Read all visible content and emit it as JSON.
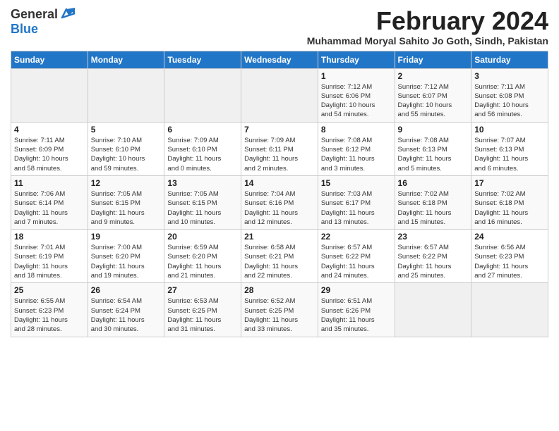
{
  "header": {
    "logo_general": "General",
    "logo_blue": "Blue",
    "title": "February 2024",
    "subtitle": "Muhammad Moryal Sahito Jo Goth, Sindh, Pakistan"
  },
  "days_of_week": [
    "Sunday",
    "Monday",
    "Tuesday",
    "Wednesday",
    "Thursday",
    "Friday",
    "Saturday"
  ],
  "weeks": [
    [
      {
        "day": "",
        "info": ""
      },
      {
        "day": "",
        "info": ""
      },
      {
        "day": "",
        "info": ""
      },
      {
        "day": "",
        "info": ""
      },
      {
        "day": "1",
        "info": "Sunrise: 7:12 AM\nSunset: 6:06 PM\nDaylight: 10 hours\nand 54 minutes."
      },
      {
        "day": "2",
        "info": "Sunrise: 7:12 AM\nSunset: 6:07 PM\nDaylight: 10 hours\nand 55 minutes."
      },
      {
        "day": "3",
        "info": "Sunrise: 7:11 AM\nSunset: 6:08 PM\nDaylight: 10 hours\nand 56 minutes."
      }
    ],
    [
      {
        "day": "4",
        "info": "Sunrise: 7:11 AM\nSunset: 6:09 PM\nDaylight: 10 hours\nand 58 minutes."
      },
      {
        "day": "5",
        "info": "Sunrise: 7:10 AM\nSunset: 6:10 PM\nDaylight: 10 hours\nand 59 minutes."
      },
      {
        "day": "6",
        "info": "Sunrise: 7:09 AM\nSunset: 6:10 PM\nDaylight: 11 hours\nand 0 minutes."
      },
      {
        "day": "7",
        "info": "Sunrise: 7:09 AM\nSunset: 6:11 PM\nDaylight: 11 hours\nand 2 minutes."
      },
      {
        "day": "8",
        "info": "Sunrise: 7:08 AM\nSunset: 6:12 PM\nDaylight: 11 hours\nand 3 minutes."
      },
      {
        "day": "9",
        "info": "Sunrise: 7:08 AM\nSunset: 6:13 PM\nDaylight: 11 hours\nand 5 minutes."
      },
      {
        "day": "10",
        "info": "Sunrise: 7:07 AM\nSunset: 6:13 PM\nDaylight: 11 hours\nand 6 minutes."
      }
    ],
    [
      {
        "day": "11",
        "info": "Sunrise: 7:06 AM\nSunset: 6:14 PM\nDaylight: 11 hours\nand 7 minutes."
      },
      {
        "day": "12",
        "info": "Sunrise: 7:05 AM\nSunset: 6:15 PM\nDaylight: 11 hours\nand 9 minutes."
      },
      {
        "day": "13",
        "info": "Sunrise: 7:05 AM\nSunset: 6:15 PM\nDaylight: 11 hours\nand 10 minutes."
      },
      {
        "day": "14",
        "info": "Sunrise: 7:04 AM\nSunset: 6:16 PM\nDaylight: 11 hours\nand 12 minutes."
      },
      {
        "day": "15",
        "info": "Sunrise: 7:03 AM\nSunset: 6:17 PM\nDaylight: 11 hours\nand 13 minutes."
      },
      {
        "day": "16",
        "info": "Sunrise: 7:02 AM\nSunset: 6:18 PM\nDaylight: 11 hours\nand 15 minutes."
      },
      {
        "day": "17",
        "info": "Sunrise: 7:02 AM\nSunset: 6:18 PM\nDaylight: 11 hours\nand 16 minutes."
      }
    ],
    [
      {
        "day": "18",
        "info": "Sunrise: 7:01 AM\nSunset: 6:19 PM\nDaylight: 11 hours\nand 18 minutes."
      },
      {
        "day": "19",
        "info": "Sunrise: 7:00 AM\nSunset: 6:20 PM\nDaylight: 11 hours\nand 19 minutes."
      },
      {
        "day": "20",
        "info": "Sunrise: 6:59 AM\nSunset: 6:20 PM\nDaylight: 11 hours\nand 21 minutes."
      },
      {
        "day": "21",
        "info": "Sunrise: 6:58 AM\nSunset: 6:21 PM\nDaylight: 11 hours\nand 22 minutes."
      },
      {
        "day": "22",
        "info": "Sunrise: 6:57 AM\nSunset: 6:22 PM\nDaylight: 11 hours\nand 24 minutes."
      },
      {
        "day": "23",
        "info": "Sunrise: 6:57 AM\nSunset: 6:22 PM\nDaylight: 11 hours\nand 25 minutes."
      },
      {
        "day": "24",
        "info": "Sunrise: 6:56 AM\nSunset: 6:23 PM\nDaylight: 11 hours\nand 27 minutes."
      }
    ],
    [
      {
        "day": "25",
        "info": "Sunrise: 6:55 AM\nSunset: 6:23 PM\nDaylight: 11 hours\nand 28 minutes."
      },
      {
        "day": "26",
        "info": "Sunrise: 6:54 AM\nSunset: 6:24 PM\nDaylight: 11 hours\nand 30 minutes."
      },
      {
        "day": "27",
        "info": "Sunrise: 6:53 AM\nSunset: 6:25 PM\nDaylight: 11 hours\nand 31 minutes."
      },
      {
        "day": "28",
        "info": "Sunrise: 6:52 AM\nSunset: 6:25 PM\nDaylight: 11 hours\nand 33 minutes."
      },
      {
        "day": "29",
        "info": "Sunrise: 6:51 AM\nSunset: 6:26 PM\nDaylight: 11 hours\nand 35 minutes."
      },
      {
        "day": "",
        "info": ""
      },
      {
        "day": "",
        "info": ""
      }
    ]
  ]
}
